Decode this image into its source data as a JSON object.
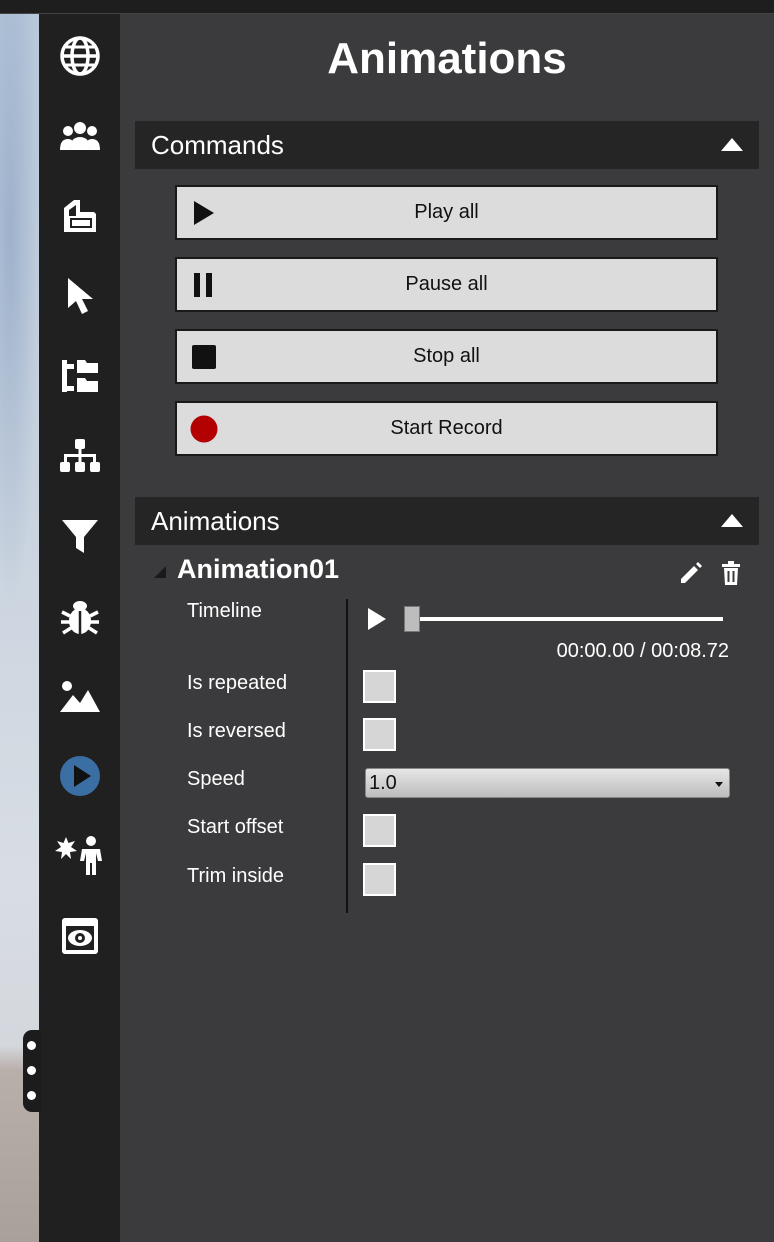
{
  "panel": {
    "title": "Animations"
  },
  "sidebar": {
    "items": [
      {
        "name": "globe-icon",
        "active": false
      },
      {
        "name": "users-icon",
        "active": false
      },
      {
        "name": "layers-icon",
        "active": false
      },
      {
        "name": "cursor-icon",
        "active": false
      },
      {
        "name": "tree-view-icon",
        "active": false
      },
      {
        "name": "hierarchy-icon",
        "active": false
      },
      {
        "name": "filter-icon",
        "active": false
      },
      {
        "name": "bug-icon",
        "active": false
      },
      {
        "name": "image-icon",
        "active": false
      },
      {
        "name": "play-circle-icon",
        "active": true
      },
      {
        "name": "effects-person-icon",
        "active": false
      },
      {
        "name": "viewer-eye-icon",
        "active": false
      }
    ]
  },
  "commands": {
    "header": "Commands",
    "buttons": [
      {
        "label": "Play all",
        "icon": "play-icon"
      },
      {
        "label": "Pause all",
        "icon": "pause-icon"
      },
      {
        "label": "Stop all",
        "icon": "stop-icon"
      },
      {
        "label": "Start Record",
        "icon": "record-icon"
      }
    ]
  },
  "animations": {
    "header": "Animations",
    "item": {
      "name": "Animation01",
      "properties": {
        "timeline_label": "Timeline",
        "time_current": "00:00.00",
        "time_separator": " / ",
        "time_total": "00:08.72",
        "progress": 0.0,
        "is_repeated_label": "Is repeated",
        "is_repeated": false,
        "is_reversed_label": "Is reversed",
        "is_reversed": false,
        "speed_label": "Speed",
        "speed_value": "1.0",
        "start_offset_label": "Start offset",
        "start_offset": false,
        "trim_inside_label": "Trim inside",
        "trim_inside": false
      }
    }
  },
  "colors": {
    "accent": "#3b6fa4",
    "record": "#b30000",
    "panel_bg": "#3b3b3d",
    "sidebar_bg": "#202020",
    "header_bg": "#252525"
  }
}
